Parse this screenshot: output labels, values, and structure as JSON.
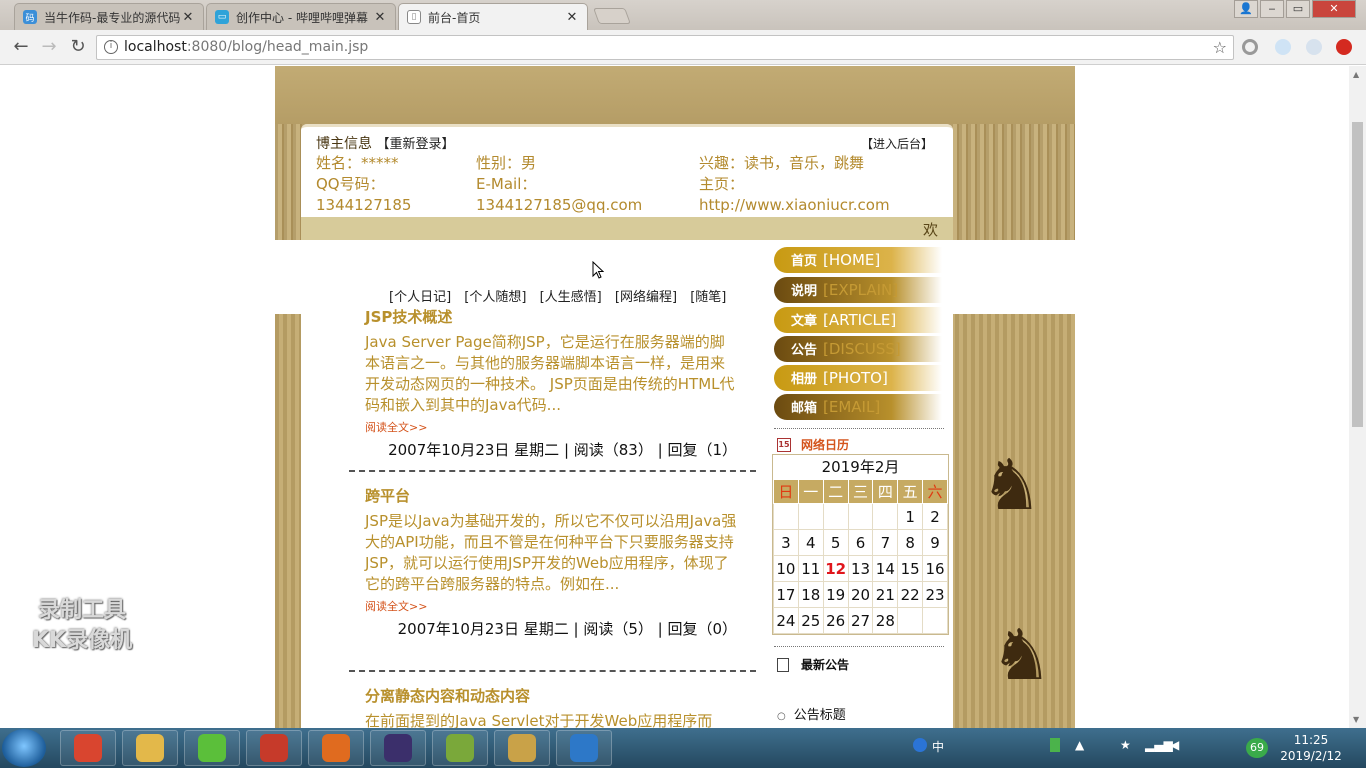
{
  "browser": {
    "tabs": [
      {
        "title": "当牛作码-最专业的源代码",
        "active": false,
        "icon_color": "#3c8fd8"
      },
      {
        "title": "创作中心 - 哔哩哔哩弹幕",
        "active": false,
        "icon_color": "#2fa3d9"
      },
      {
        "title": "前台-首页",
        "active": true,
        "icon_color": "#888888"
      }
    ],
    "url_host": "localhost",
    "url_rest": ":8080/blog/head_main.jsp",
    "window": {
      "min": "‒",
      "max": "□",
      "restore": "▭",
      "close": "✕"
    }
  },
  "blog": {
    "info_header": "博主信息",
    "relogin": "【重新登录】",
    "admin": "【进入后台】",
    "info": {
      "name": "姓名：*****",
      "qq_label": "QQ号码：",
      "qq": "1344127185",
      "gender": "性别：男",
      "email_label": "E-Mail：",
      "email": "1344127185@qq.com",
      "hobby": "兴趣：读书，音乐，跳舞",
      "home_label": "主页：",
      "home": "http://www.xiaoniucr.com"
    },
    "welcome": "欢",
    "categories": [
      "[个人日记]",
      "[个人随想]",
      "[人生感悟]",
      "[网络编程]",
      "[随笔]"
    ],
    "posts": [
      {
        "title": "JSP技术概述",
        "text": "Java Server Page简称JSP，它是运行在服务器端的脚本语言之一。与其他的服务器端脚本语言一样，是用来开发动态网页的一种技术。 JSP页面是由传统的HTML代码和嵌入到其中的Java代码...",
        "more": "阅读全文>>",
        "meta": "2007年10月23日 星期二 | 阅读（83） | 回复（1）"
      },
      {
        "title": "跨平台",
        "text": "JSP是以Java为基础开发的，所以它不仅可以沿用Java强大的API功能，而且不管是在何种平台下只要服务器支持JSP，就可以运行使用JSP开发的Web应用程序，体现了它的跨平台跨服务器的特点。例如在...",
        "more": "阅读全文>>",
        "meta": "2007年10月23日 星期二 | 阅读（5） | 回复（0）"
      },
      {
        "title": "分离静态内容和动态内容",
        "text": "在前面提到的Java Servlet对于开发Web应用程序而",
        "more": "",
        "meta": ""
      }
    ],
    "menu": [
      {
        "cn": "首页",
        "en": "[HOME]",
        "style": "light"
      },
      {
        "cn": "说明",
        "en": "[EXPLAIN]",
        "style": "dark"
      },
      {
        "cn": "文章",
        "en": "[ARTICLE]",
        "style": "light"
      },
      {
        "cn": "公告",
        "en": "[DISCUSS]",
        "style": "dark"
      },
      {
        "cn": "相册",
        "en": "[PHOTO]",
        "style": "light"
      },
      {
        "cn": "邮箱",
        "en": "[EMAIL]",
        "style": "dark"
      }
    ],
    "calendar": {
      "heading": "网络日历",
      "icon_day": "15",
      "month": "2019年2月",
      "weekdays": [
        "日",
        "一",
        "二",
        "三",
        "四",
        "五",
        "六"
      ],
      "weeks": [
        [
          "",
          "",
          "",
          "",
          "",
          "1",
          "2"
        ],
        [
          "3",
          "4",
          "5",
          "6",
          "7",
          "8",
          "9"
        ],
        [
          "10",
          "11",
          "12",
          "13",
          "14",
          "15",
          "16"
        ],
        [
          "17",
          "18",
          "19",
          "20",
          "21",
          "22",
          "23"
        ],
        [
          "24",
          "25",
          "26",
          "27",
          "28",
          "",
          ""
        ]
      ],
      "today": "12"
    },
    "notices_heading": "最新公告",
    "notice_item": "公告标题"
  },
  "watermark": {
    "line1": "录制工具",
    "line2": "KK录像机"
  },
  "taskbar": {
    "apps": [
      {
        "name": "chrome",
        "color": "#d9452f"
      },
      {
        "name": "explorer",
        "color": "#e3b84a"
      },
      {
        "name": "green-app",
        "color": "#5bbf3a"
      },
      {
        "name": "paint-app",
        "color": "#c63a2a"
      },
      {
        "name": "recorder",
        "color": "#e06b1f"
      },
      {
        "name": "javaee-ide",
        "color": "#3b2f6b"
      },
      {
        "name": "notepad",
        "color": "#7aa83a"
      },
      {
        "name": "tools",
        "color": "#c9a248"
      },
      {
        "name": "editor",
        "color": "#2d78c8"
      }
    ],
    "tray_text": "中",
    "badge": "69",
    "time": "11:25",
    "date": "2019/2/12"
  }
}
